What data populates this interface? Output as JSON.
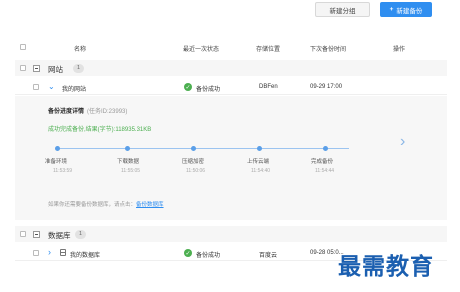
{
  "toolbar": {
    "new_group_label": "新建分组",
    "new_backup_plus": "+",
    "new_backup_label": "新建备份"
  },
  "table_header": {
    "name": "名称",
    "last_status": "最近一次状态",
    "storage": "存储位置",
    "next_backup_time": "下次备份时间",
    "actions": "操作"
  },
  "groups": [
    {
      "name": "网站",
      "count": "1",
      "items": [
        {
          "name": "我的网站",
          "status": "备份成功",
          "storage": "DBFen",
          "next_time": "09-29 17:00"
        }
      ]
    },
    {
      "name": "数据库",
      "count": "1",
      "items": [
        {
          "name": "我的数据库",
          "status": "备份成功",
          "storage": "百度云",
          "next_time": "09-28 05:0..."
        }
      ]
    }
  ],
  "detail": {
    "title": "备份进度详情",
    "task_id": "(任务ID:23993)",
    "success_text": "成功完成备份,结果(字节):118935.31KB",
    "steps": [
      {
        "label": "准备环境",
        "time": "11:53:59"
      },
      {
        "label": "下载数据",
        "time": "11:55:05"
      },
      {
        "label": "压缩加密",
        "time": "11:50:06"
      },
      {
        "label": "上传云端",
        "time": "11:54:40"
      },
      {
        "label": "完成备份",
        "time": "11:54:44"
      }
    ],
    "note_prefix": "如果你还需要备份数据库，请点击：",
    "note_link": "备份数据库"
  },
  "watermark": "最需教育",
  "colors": {
    "accent": "#2f8ef0",
    "success": "#4caf50",
    "watermark": "#1b5fb0"
  }
}
